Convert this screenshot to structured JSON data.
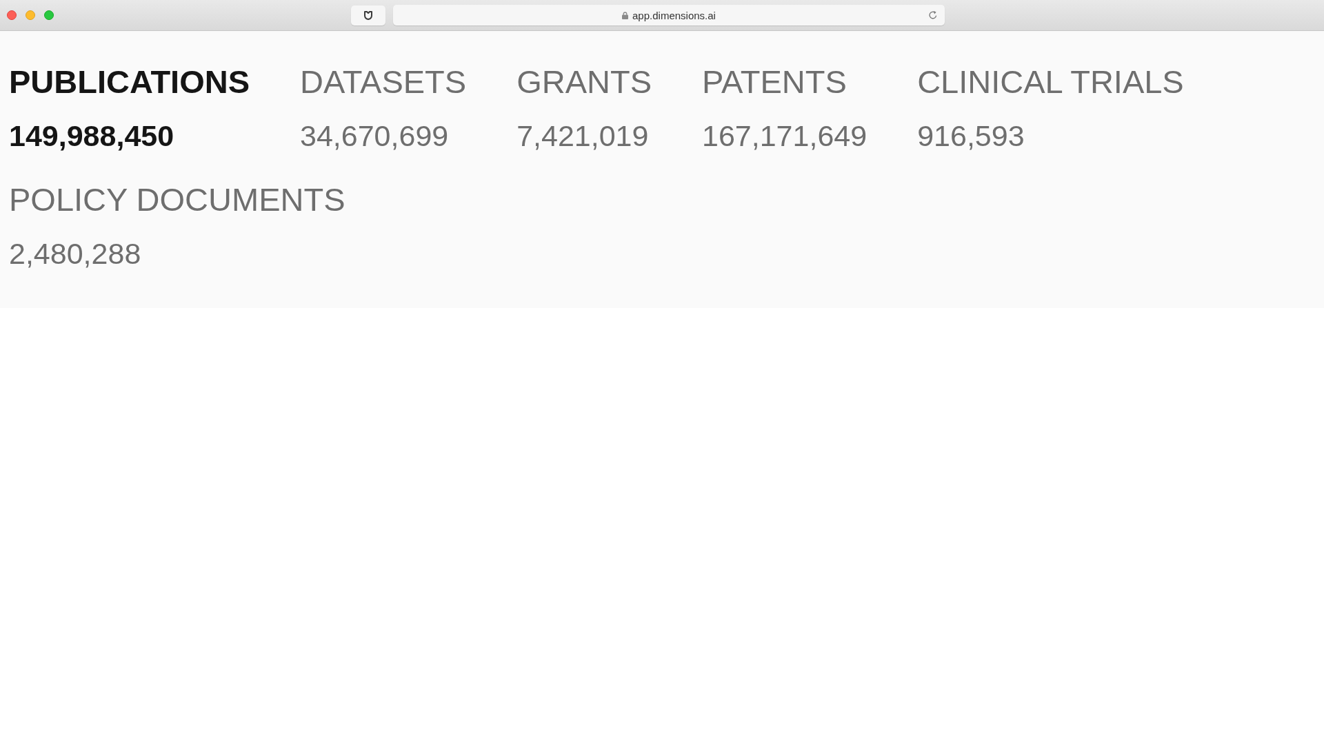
{
  "browser": {
    "url": "app.dimensions.ai"
  },
  "tabs": [
    {
      "label": "PUBLICATIONS",
      "count": "149,988,450",
      "selected": true
    },
    {
      "label": "DATASETS",
      "count": "34,670,699",
      "selected": false
    },
    {
      "label": "GRANTS",
      "count": "7,421,019",
      "selected": false
    },
    {
      "label": "PATENTS",
      "count": "167,171,649",
      "selected": false
    },
    {
      "label": "CLINICAL TRIALS",
      "count": "916,593",
      "selected": false
    },
    {
      "label": "POLICY DOCUMENTS",
      "count": "2,480,288",
      "selected": false
    }
  ]
}
